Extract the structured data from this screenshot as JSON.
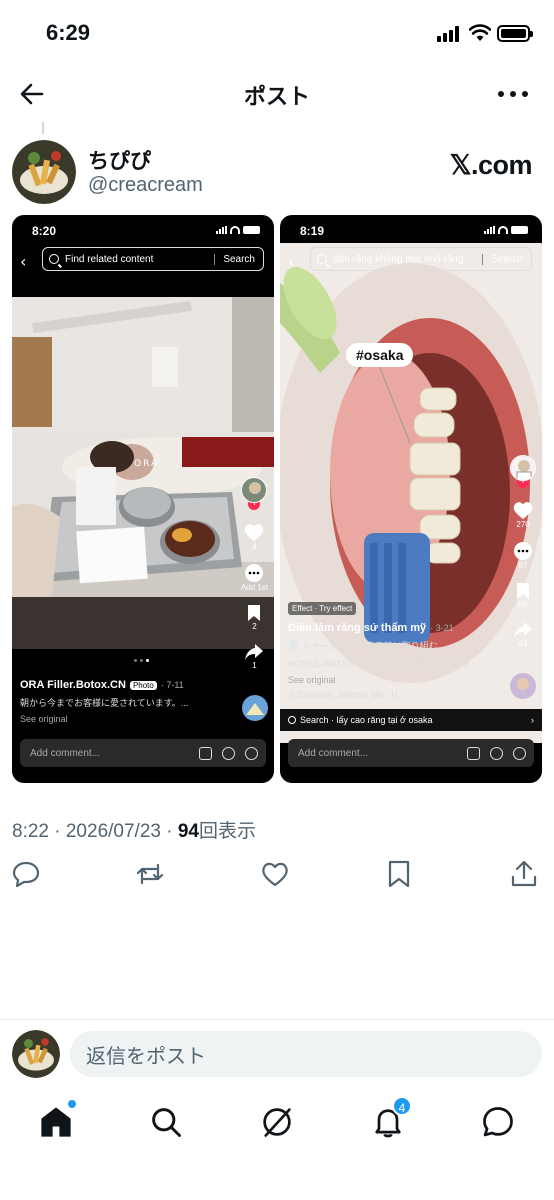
{
  "status_bar": {
    "time": "6:29"
  },
  "header": {
    "title": "ポスト"
  },
  "author": {
    "display_name": "ちぴぴ",
    "handle": "@creacream",
    "source_label": "𝕏.com"
  },
  "media": [
    {
      "time": "8:20",
      "search_query": "Find related content",
      "search_button": "Search",
      "watermark": "ORA",
      "rail": {
        "likes": "4",
        "add_label": "Add 1st",
        "saves": "2",
        "shares": "1"
      },
      "title": "ORA Filler.Botox.CN",
      "badge": "Photo",
      "date": "· 7-11",
      "caption": "朝から今までお客様に愛されています。...",
      "see_original": "See original",
      "comment_placeholder": "Add comment..."
    },
    {
      "time": "8:19",
      "search_query": "dán răng không mài nhỏ răng",
      "search_button": "Search",
      "tag": "#osaka",
      "rail": {
        "likes": "270",
        "comments": "87",
        "saves": "86",
        "shares": "43"
      },
      "effect_label": "Effect · Try effect",
      "title": "Diệu lâm răng sứ thẩm mỹ",
      "date": "· 3-21",
      "caption1": "🦷 トゥースペース 徹底的に取り組む、",
      "caption2": "HORSE-WATER-LIFE +小さな研削歯... more",
      "see_original": "See original",
      "music": "♫ Contains: Without Me - H...",
      "search_suggestion": "Search · lấy cao răng tại ở osaka",
      "comment_placeholder": "Add comment..."
    }
  ],
  "meta": {
    "timestamp": "8:22 · 2026/07/23 · ",
    "views_count": "94",
    "views_label": "回表示"
  },
  "reply": {
    "placeholder": "返信をポスト"
  },
  "tabbar": {
    "notifications_badge": "4"
  },
  "colors": {
    "accent": "#1d9bf0",
    "text": "#0f1419",
    "secondary": "#536471"
  }
}
